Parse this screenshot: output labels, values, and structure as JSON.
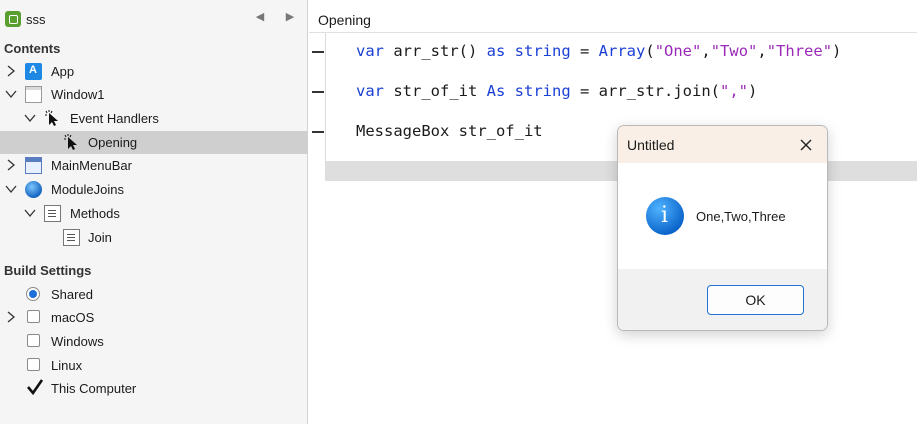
{
  "project": {
    "name": "sss",
    "back_icon": "back-arrow-icon",
    "forward_icon": "forward-arrow-icon"
  },
  "sections": {
    "contents": "Contents",
    "build_settings": "Build Settings"
  },
  "tree": [
    {
      "label": "App",
      "icon": "app-icon"
    },
    {
      "label": "Window1",
      "icon": "window-icon"
    },
    {
      "label": "Event Handlers",
      "icon": "cursor-icon"
    },
    {
      "label": "Opening",
      "icon": "cursor-icon",
      "selected": true
    },
    {
      "label": "MainMenuBar",
      "icon": "menubar-icon"
    },
    {
      "label": "ModuleJoins",
      "icon": "module-icon"
    },
    {
      "label": "Methods",
      "icon": "methods-icon"
    },
    {
      "label": "Join",
      "icon": "method-icon"
    }
  ],
  "build": [
    {
      "label": "Shared",
      "control": "radio",
      "checked": true
    },
    {
      "label": "macOS",
      "control": "checkbox",
      "checked": false
    },
    {
      "label": "Windows",
      "control": "checkbox",
      "checked": false
    },
    {
      "label": "Linux",
      "control": "checkbox",
      "checked": false
    },
    {
      "label": "This Computer",
      "control": "checkbox",
      "checked": true
    }
  ],
  "editor": {
    "tab": "Opening",
    "lines": [
      {
        "kw1": "var",
        "t1": " arr_str() ",
        "kw2": "as",
        "t2": " ",
        "kw3": "string",
        "t3": " = ",
        "kw4": "Array",
        "t4": "(",
        "s1": "\"One\"",
        "t5": ",",
        "s2": "\"Two\"",
        "t6": ",",
        "s3": "\"Three\"",
        "t7": ")"
      },
      {
        "kw1": "var",
        "t1": " str_of_it ",
        "kw2": "As",
        "t2": " ",
        "kw3": "string",
        "t3": " = arr_str.join(",
        "s1": "\",\"",
        "t4": ")"
      },
      {
        "t1": "MessageBox str_of_it"
      }
    ]
  },
  "dialog": {
    "title": "Untitled",
    "close_icon": "close-icon",
    "info_icon": "info-icon",
    "message": "One,Two,Three",
    "ok_label": "OK"
  },
  "colors": {
    "keyword": "#1a3fd4",
    "string": "#9a2ab8",
    "selected_row": "#cfcfcf",
    "dialog_title_bg": "#f9efe6",
    "button_border": "#1f74d0"
  }
}
